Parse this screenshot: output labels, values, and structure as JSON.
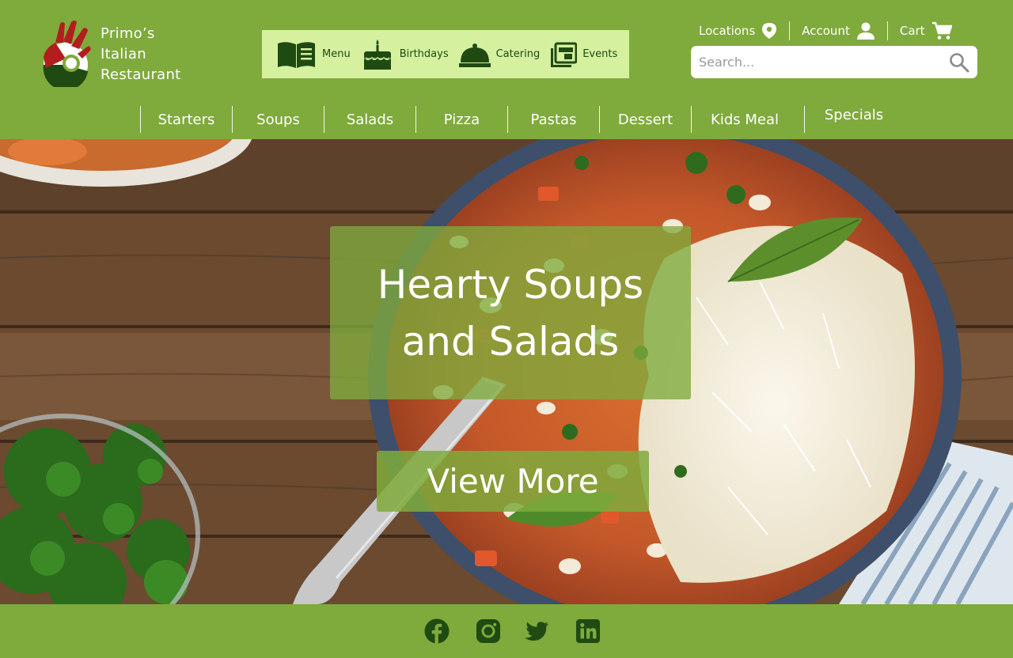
{
  "brand": {
    "name_lines": [
      "Primo’s",
      "Italian",
      "Restaurant"
    ],
    "logo_icon": "hand-ok-logo-icon",
    "colors": {
      "primary_green": "#7faa3c",
      "promo_bg": "#d5f1a0",
      "dark_green": "#1f4a12",
      "logo_red": "#b21d1d"
    }
  },
  "promo_links": [
    {
      "label": "Menu",
      "icon": "menu-book-icon"
    },
    {
      "label": "Birthdays",
      "icon": "birthday-cake-icon"
    },
    {
      "label": "Catering",
      "icon": "cloche-icon"
    },
    {
      "label": "Events",
      "icon": "events-calendar-icon"
    }
  ],
  "utility": {
    "locations": {
      "label": "Locations",
      "icon": "location-pin-icon"
    },
    "account": {
      "label": "Account",
      "icon": "user-icon"
    },
    "cart": {
      "label": "Cart",
      "icon": "cart-icon"
    }
  },
  "search": {
    "placeholder": "Search...",
    "value": "",
    "icon": "search-icon"
  },
  "categories": [
    "Starters",
    "Soups",
    "Salads",
    "Pizza",
    "Pastas",
    "Dessert",
    "Kids Meal",
    "Specials"
  ],
  "hero": {
    "title_line1": "Hearty Soups",
    "title_line2": "and Salads",
    "cta_label": "View More"
  },
  "footer": {
    "social": [
      {
        "name": "facebook",
        "icon": "facebook-icon"
      },
      {
        "name": "instagram",
        "icon": "instagram-icon"
      },
      {
        "name": "twitter",
        "icon": "twitter-icon"
      },
      {
        "name": "linkedin",
        "icon": "linkedin-icon"
      }
    ]
  }
}
